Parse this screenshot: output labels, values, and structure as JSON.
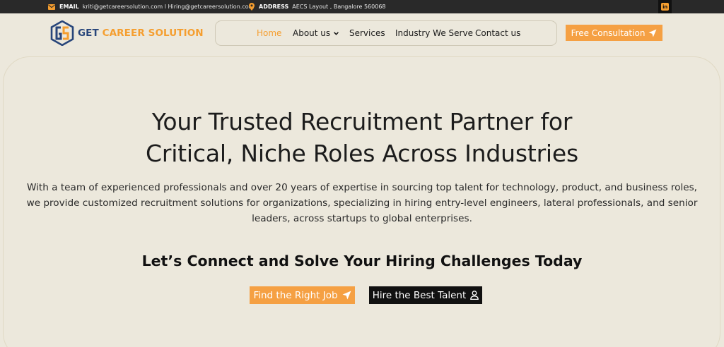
{
  "topbar": {
    "email_label": "EMAIL",
    "email_value": "kriti@getcareersolution.com  l Hiring@getcareersolution.com",
    "address_label": "ADDRESS",
    "address_value": "AECS Layout , Bangalore 560068",
    "linkedin_glyph": "in"
  },
  "brand": {
    "logo_mark": "GS",
    "name_first": "GET",
    "name_rest": "CAREER SOLUTION",
    "primary_color": "#27457a",
    "accent_color": "#f59e2f"
  },
  "nav": {
    "items": [
      {
        "label": "Home",
        "active": true
      },
      {
        "label": "About us",
        "dropdown": true
      },
      {
        "label": "Services"
      },
      {
        "label": "Industry We Serve"
      },
      {
        "label": "Contact us"
      }
    ],
    "cta_label": "Free Consultation"
  },
  "hero": {
    "title_line1": "Your Trusted Recruitment Partner for",
    "title_line2": "Critical, Niche Roles Across Industries",
    "desc_line1": "With a team of experienced professionals and over 20 years of expertise in sourcing top talent for technology, product, and business roles,",
    "desc_line2": "we provide customized recruitment solutions for organizations, specializing in hiring entry-level engineers, lateral professionals, and senior",
    "desc_line3": "leaders, across startups to global enterprises.",
    "subtitle": "Let’s Connect and Solve Your Hiring Challenges Today",
    "btn_job": "Find the Right Job",
    "btn_hire": "Hire the Best Talent"
  },
  "icons": {
    "email": "envelope-icon",
    "address": "map-pin-icon",
    "linkedin": "linkedin-icon",
    "send": "paper-plane-icon",
    "user": "user-icon",
    "chevron": "chevron-down-icon"
  }
}
